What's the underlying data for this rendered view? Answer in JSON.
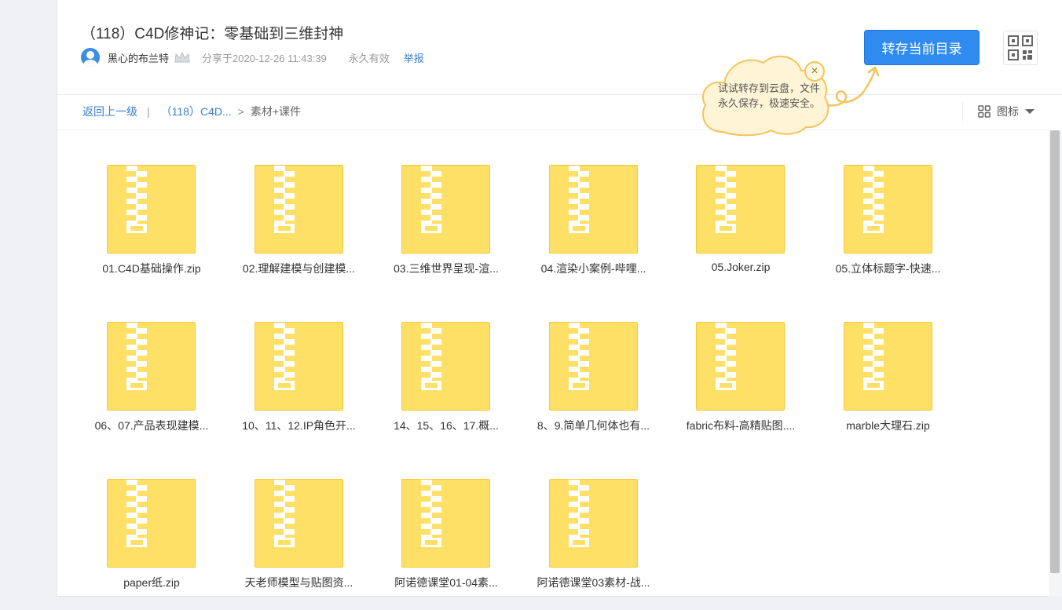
{
  "header": {
    "title": "（118）C4D修神记：零基础到三维封神",
    "username": "黑心的布兰特",
    "share_time": "分享于2020-12-26 11:43:39",
    "validity": "永久有效",
    "report": "举报",
    "save_button": "转存当前目录"
  },
  "tip": {
    "text": "试试转存到云盘，文件永久保存，极速安全。",
    "close": "×"
  },
  "breadcrumb": {
    "back": "返回上一级",
    "pipe": "|",
    "parent": "（118）C4D...",
    "arrow": ">",
    "current": "素材+课件"
  },
  "view_toggle": {
    "label": "图标"
  },
  "colors": {
    "accent": "#2f8bf0",
    "zip": "#ffe066",
    "link": "#3a7fcf"
  },
  "files": [
    "01.C4D基础操作.zip",
    "02.理解建模与创建模...",
    "03.三维世界呈现-渲...",
    "04.渲染小案例-哔哩...",
    "05.Joker.zip",
    "05.立体标题字-快速...",
    "06、07.产品表现建模...",
    "10、11、12.IP角色开...",
    "14、15、16、17.概...",
    "8、9.简单几何体也有...",
    "fabric布料-高精贴图....",
    "marble大理石.zip",
    "paper纸.zip",
    "天老师模型与贴图资...",
    "阿诺德课堂01-04素...",
    "阿诺德课堂03素材-战..."
  ]
}
